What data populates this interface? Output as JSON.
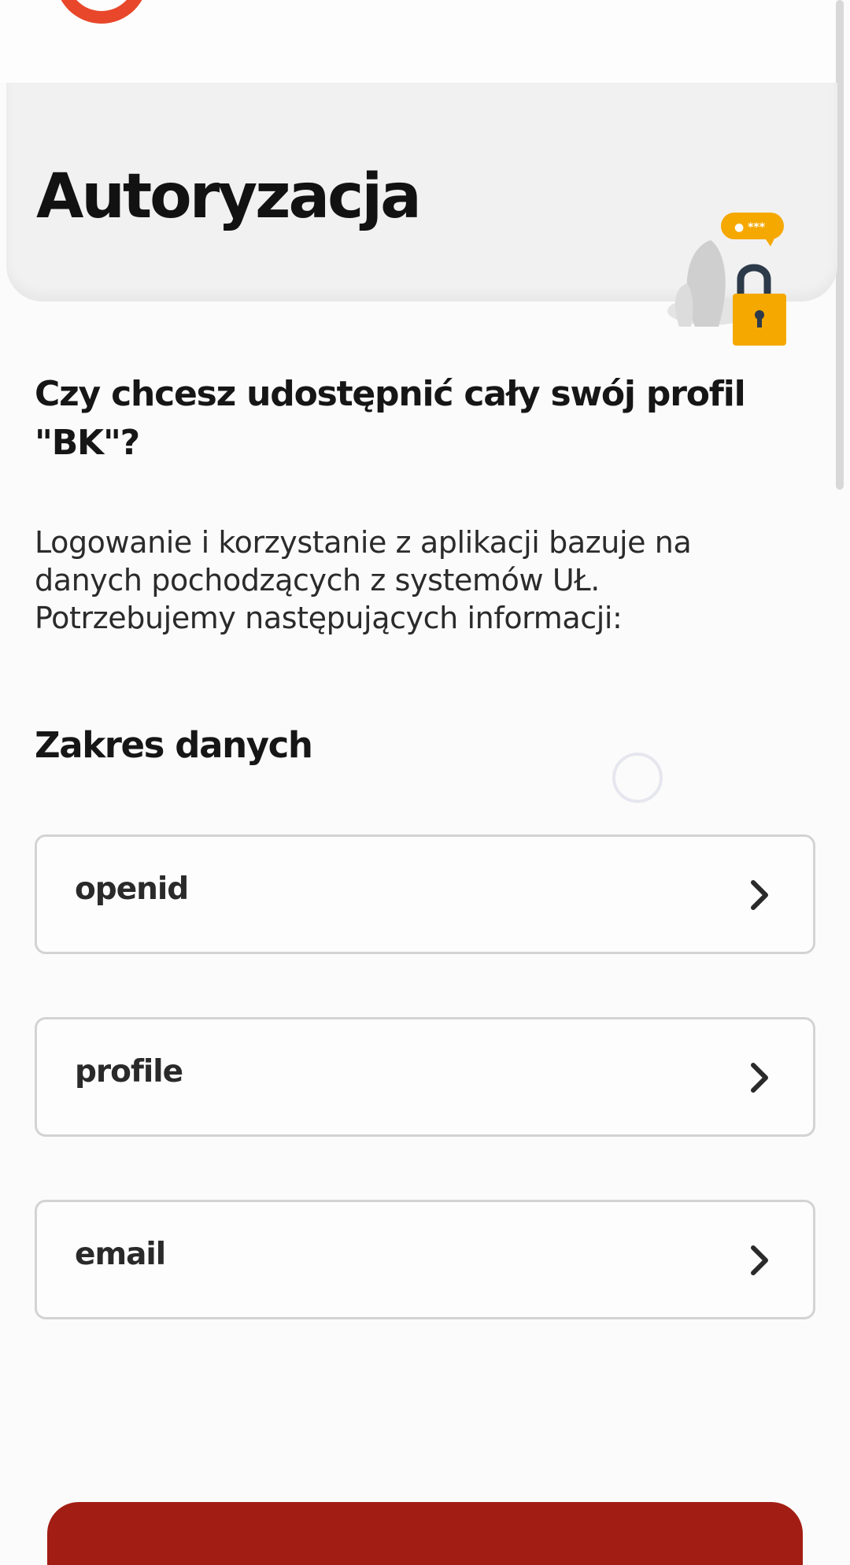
{
  "header": {
    "title": "Autoryzacja",
    "illustration_bubble_text": "🔒 ***"
  },
  "consent": {
    "question": "Czy chcesz udostępnić cały swój profil \"BK\"?",
    "description": "Logowanie i korzystanie z aplikacji bazuje na danych pochodzących z systemów UŁ. Potrzebujemy następujących informacji:"
  },
  "scopes": {
    "heading": "Zakres danych",
    "items": [
      {
        "label": "openid"
      },
      {
        "label": "profile"
      },
      {
        "label": "email"
      }
    ]
  },
  "colors": {
    "brand": "#e8472b",
    "primary_button": "#a21e14",
    "lock": "#f5a800"
  },
  "icons": [
    "app-logo-icon",
    "padlock-icon",
    "chevron-right-icon",
    "loading-spinner-icon"
  ]
}
